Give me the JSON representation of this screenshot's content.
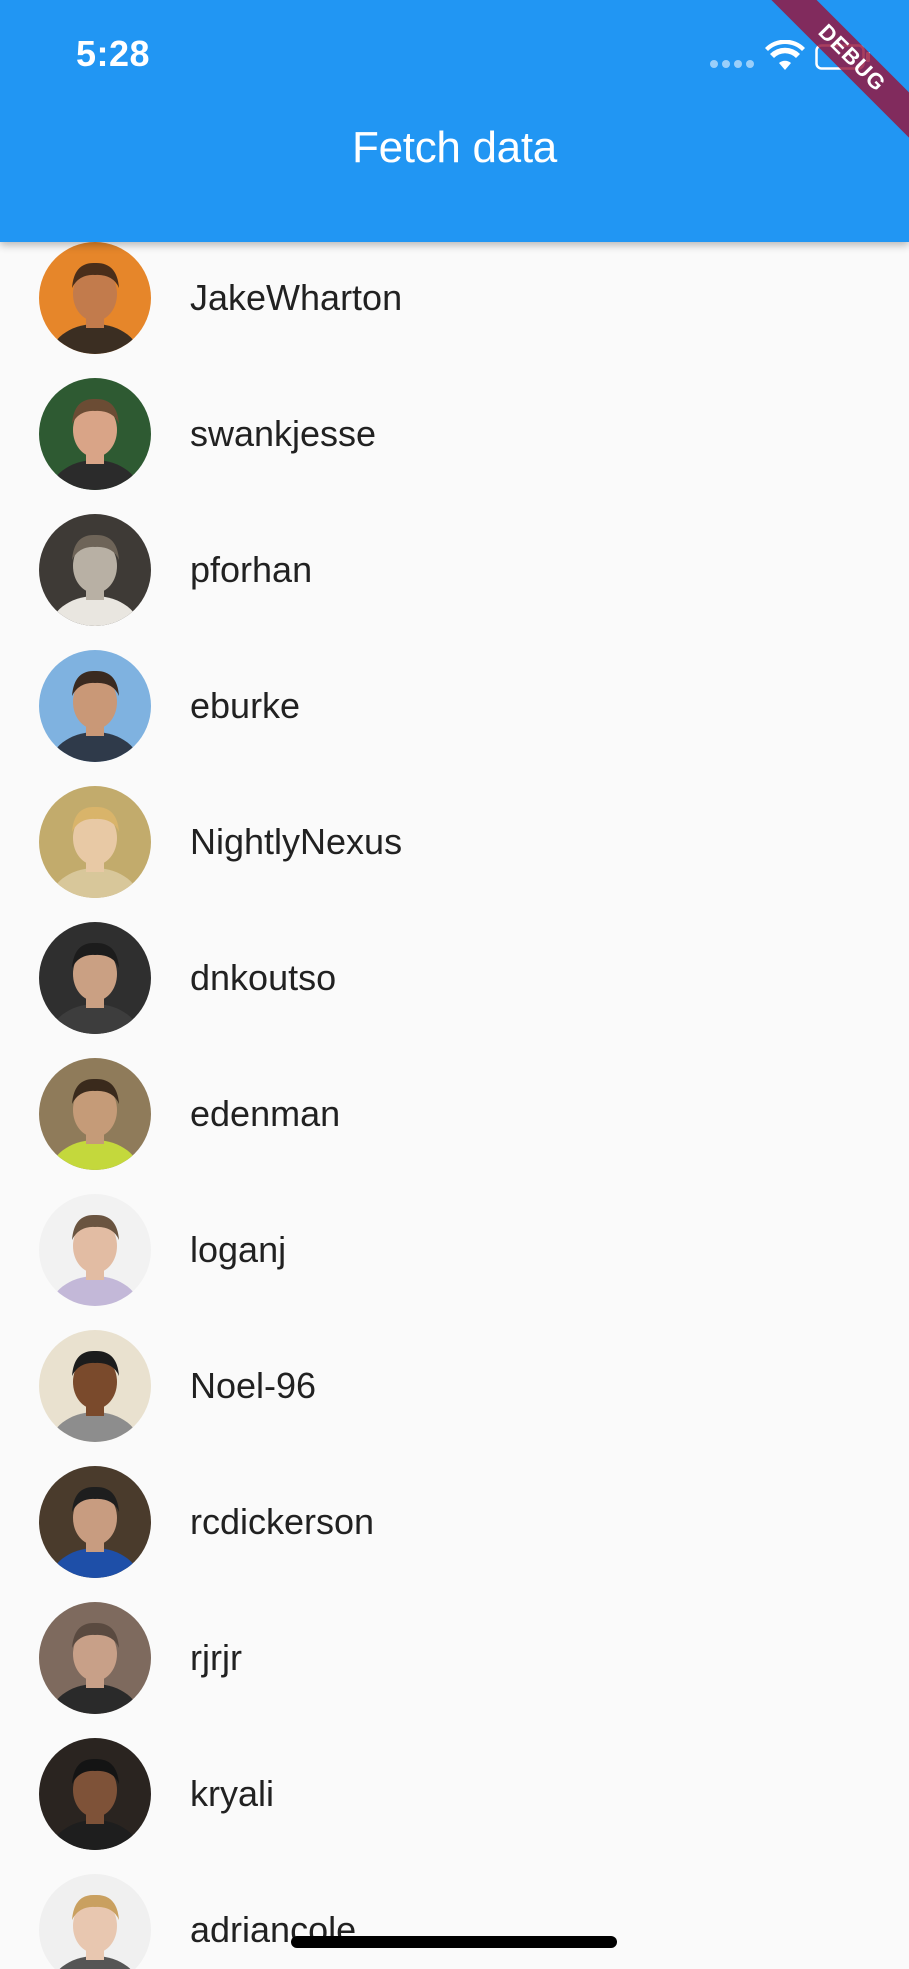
{
  "status_bar": {
    "time": "5:28"
  },
  "app_bar": {
    "title": "Fetch data"
  },
  "debug_banner": {
    "label": "DEBUG"
  },
  "users": [
    {
      "login": "JakeWharton",
      "avatar": {
        "bg": "#e6862a",
        "skin": "#c27b4c",
        "hair": "#4a2e1a",
        "shirt": "#3b2e22"
      }
    },
    {
      "login": "swankjesse",
      "avatar": {
        "bg": "#2e5a32",
        "skin": "#d9a487",
        "hair": "#6b4c34",
        "shirt": "#2b2b2b"
      }
    },
    {
      "login": "pforhan",
      "avatar": {
        "bg": "#3e3a36",
        "skin": "#b8b0a4",
        "hair": "#6e6458",
        "shirt": "#e9e6e0"
      }
    },
    {
      "login": "eburke",
      "avatar": {
        "bg": "#7fb2e0",
        "skin": "#c99877",
        "hair": "#3a2a20",
        "shirt": "#2f3a4a"
      }
    },
    {
      "login": "NightlyNexus",
      "avatar": {
        "bg": "#c2ab6c",
        "skin": "#e8c9a5",
        "hair": "#d9b46a",
        "shirt": "#d8c79a"
      }
    },
    {
      "login": "dnkoutso",
      "avatar": {
        "bg": "#2f2f2f",
        "skin": "#caa083",
        "hair": "#1c1c1c",
        "shirt": "#3d3d3d"
      }
    },
    {
      "login": "edenman",
      "avatar": {
        "bg": "#8f7b5a",
        "skin": "#c59b78",
        "hair": "#3a2a1c",
        "shirt": "#c4d83c"
      }
    },
    {
      "login": "loganj",
      "avatar": {
        "bg": "#f2f2f2",
        "skin": "#e2bca3",
        "hair": "#6a5440",
        "shirt": "#c3b8d8"
      }
    },
    {
      "login": "Noel-96",
      "avatar": {
        "bg": "#e9e1cf",
        "skin": "#7a4a2c",
        "hair": "#1c1c1c",
        "shirt": "#8d8d8d"
      }
    },
    {
      "login": "rcdickerson",
      "avatar": {
        "bg": "#4a3b2c",
        "skin": "#c89c80",
        "hair": "#1e1e1e",
        "shirt": "#1e4fa8"
      }
    },
    {
      "login": "rjrjr",
      "avatar": {
        "bg": "#7e6a5e",
        "skin": "#c8a088",
        "hair": "#5a4a40",
        "shirt": "#2a2a2a"
      }
    },
    {
      "login": "kryali",
      "avatar": {
        "bg": "#2a2420",
        "skin": "#7e5238",
        "hair": "#141414",
        "shirt": "#1e1e1e"
      }
    },
    {
      "login": "adriancole",
      "avatar": {
        "bg": "#f0f0f0",
        "skin": "#e8c7b0",
        "hair": "#c9a060",
        "shirt": "#555555"
      }
    }
  ]
}
